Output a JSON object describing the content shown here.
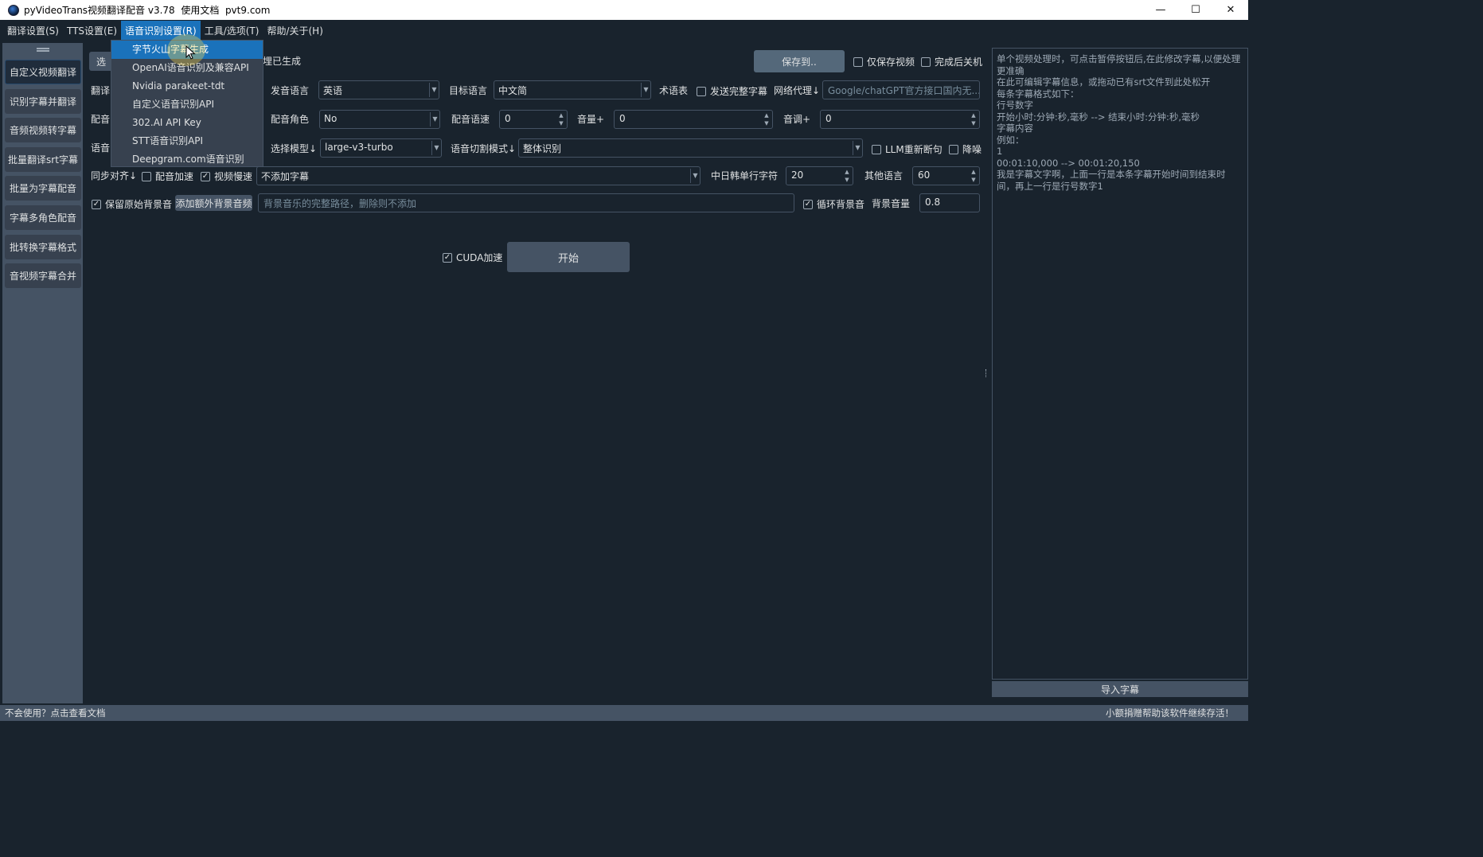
{
  "window": {
    "title": "pyVideoTrans视频翻译配音 v3.78  使用文档  pvt9.com",
    "minimize": "—",
    "maximize": "☐",
    "close": "✕"
  },
  "menubar": {
    "items": [
      "翻译设置(S)",
      "TTS设置(E)",
      "语音识别设置(R)",
      "工具/选项(T)",
      "帮助/关于(H)"
    ]
  },
  "dropdown": {
    "items": [
      "字节火山字幕生成",
      "OpenAI语音识别及兼容API",
      "Nvidia parakeet-tdt",
      "自定义语音识别API",
      "302.AI API Key",
      "STT语音识别API",
      "Deepgram.com语音识别"
    ]
  },
  "sidebar": {
    "items": [
      "自定义视频翻译",
      "识别字幕并翻译",
      "音频视频转字幕",
      "批量翻译srt字幕",
      "批量为字幕配音",
      "字幕多角色配音",
      "批转换字幕格式",
      "音视频字幕合并"
    ]
  },
  "main": {
    "row0": {
      "select_label_partial": "选",
      "hint_partial": "埋已生成",
      "save_button": "保存到..",
      "only_video": "仅保存视频",
      "shutdown": "完成后关机"
    },
    "row1": {
      "translate_label_partial": "翻译:",
      "source_lang_label": "发音语言",
      "source_lang_value": "英语",
      "target_lang_label": "目标语言",
      "target_lang_value": "中文简",
      "glossary_label": "术语表",
      "send_full_subtitle": "发送完整字幕",
      "proxy_label": "网络代理↓",
      "proxy_placeholder": "Google/chatGPT官方接口国内无..."
    },
    "row2": {
      "dub_label_partial": "配音:",
      "voice_role_label": "配音角色",
      "voice_role_value": "No",
      "voice_rate_label": "配音语速",
      "voice_rate_value": "0",
      "volume_label": "音量+",
      "volume_value": "0",
      "pitch_label": "音调+",
      "pitch_value": "0"
    },
    "row3": {
      "speech_label_partial": "语音:",
      "model_label": "选择模型↓",
      "model_value": "large-v3-turbo",
      "split_mode_label": "语音切割模式↓",
      "split_mode_value": "整体识别",
      "llm_resegment": "LLM重新断句",
      "denoise": "降噪"
    },
    "row4": {
      "sync_label": "同步对齐↓",
      "dub_speedup": "配音加速",
      "video_slowdown": "视频慢速",
      "subtitle_mode_value": "不添加字幕",
      "cjk_chars_label": "中日韩单行字符",
      "cjk_chars_value": "20",
      "other_lang_label": "其他语言",
      "other_lang_value": "60"
    },
    "row5": {
      "keep_bg": "保留原始背景音",
      "add_bg_button": "添加额外背景音频",
      "bg_path_placeholder": "背景音乐的完整路径，删除则不添加",
      "loop_bg": "循环背景音",
      "bg_volume_label": "背景音量",
      "bg_volume_value": "0.8"
    },
    "start": {
      "cuda": "CUDA加速",
      "start_button": "开始"
    }
  },
  "rightpanel": {
    "lines": [
      "单个视频处理时，可点击暂停按钮后,在此修改字幕,以便处理更准确",
      "",
      "在此可编辑字幕信息，或拖动已有srt文件到此处松开",
      "",
      "每条字幕格式如下：",
      "",
      "行号数字",
      "开始小时:分钟:秒,毫秒 --> 结束小时:分钟:秒,毫秒",
      "字幕内容",
      "",
      "例如：",
      "",
      "1",
      "00:01:10,000 --> 00:01:20,150",
      "我是字幕文字啊，上面一行是本条字幕开始时间到结束时间，再上一行是行号数字1"
    ],
    "import_button": "导入字幕"
  },
  "statusbar": {
    "left": "不会使用？点击查看文档",
    "right": "小额捐赠帮助该软件继续存活！"
  },
  "colors": {
    "background": "#19232d",
    "panel": "#455364",
    "accent": "#1a72bb"
  }
}
